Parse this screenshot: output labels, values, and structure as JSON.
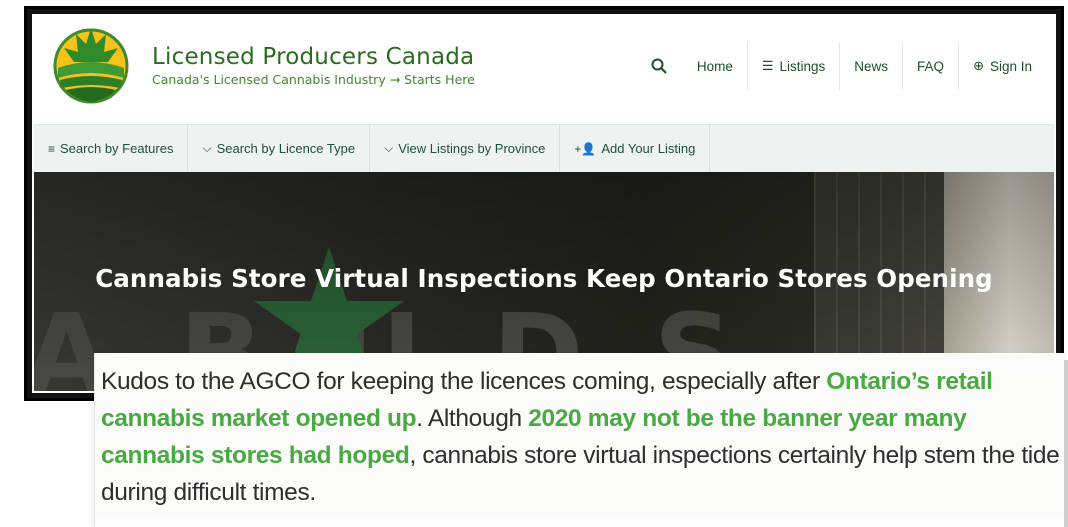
{
  "brand": {
    "title": "Licensed Producers Canada",
    "tagline": "Canada's Licensed Cannabis Industry → Starts Here"
  },
  "topnav": {
    "search_icon": "search-icon",
    "items": [
      {
        "label": "Home"
      },
      {
        "label": "Listings",
        "icon": "list-icon"
      },
      {
        "label": "News"
      },
      {
        "label": "FAQ"
      },
      {
        "label": "Sign In",
        "icon": "sign-in-icon"
      }
    ]
  },
  "subnav": {
    "items": [
      {
        "label": "Search by Features",
        "icon": "hamburger-icon"
      },
      {
        "label": "Search by Licence Type",
        "icon": "chevron-down-icon"
      },
      {
        "label": "View Listings by Province",
        "icon": "chevron-down-icon"
      },
      {
        "label": "Add Your Listing",
        "icon": "add-user-icon"
      }
    ]
  },
  "hero": {
    "title": "Cannabis Store Virtual Inspections Keep Ontario Stores Opening"
  },
  "excerpt": {
    "part1": "Kudos to the AGCO for keeping the licences coming, especially after ",
    "link1": "Ontario’s retail cannabis market opened up",
    "part2": ". Although ",
    "link2": "2020 may not be the banner year many cannabis stores had hoped",
    "part3": ", cannabis store virtual inspections certainly help stem the tide during difficult times."
  },
  "colors": {
    "brand_green": "#2a6b1f",
    "link_green": "#49a942",
    "subnav_bg": "#eef3f1"
  }
}
